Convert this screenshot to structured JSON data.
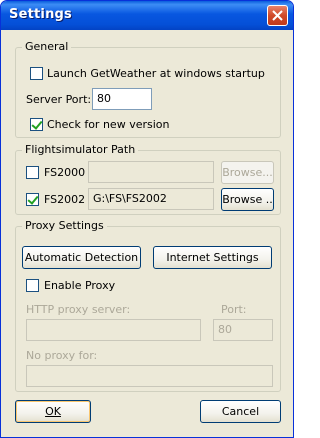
{
  "window": {
    "title": "Settings"
  },
  "general": {
    "title": "General",
    "launch_label": "Launch GetWeather at windows startup",
    "launch_checked": false,
    "server_port_label": "Server Port:",
    "server_port_value": "80",
    "check_version_label": "Check for new version",
    "check_version_checked": true
  },
  "flightsim": {
    "title": "Flightsimulator Path",
    "fs2000_label": "FS2000",
    "fs2000_checked": false,
    "fs2000_path": "",
    "fs2000_browse": "Browse...",
    "fs2002_label": "FS2002",
    "fs2002_checked": true,
    "fs2002_path": "G:\\FS\\FS2002",
    "fs2002_browse": "Browse .."
  },
  "proxy": {
    "title": "Proxy Settings",
    "auto_detect_button": "Automatic Detection",
    "internet_settings_button": "Internet Settings",
    "enable_proxy_label": "Enable Proxy",
    "enable_proxy_checked": false,
    "http_server_label": "HTTP proxy server:",
    "http_server_value": "",
    "port_label": "Port:",
    "port_value": "80",
    "no_proxy_label": "No proxy for:",
    "no_proxy_value": ""
  },
  "footer": {
    "ok_button": "OK",
    "cancel_button": "Cancel"
  }
}
